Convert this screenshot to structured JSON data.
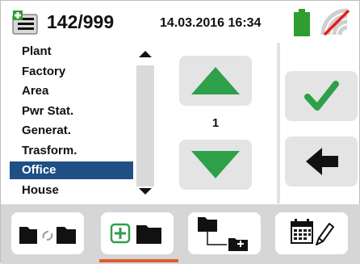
{
  "header": {
    "memory_count": "142/999",
    "datetime": "14.03.2016  16:34",
    "icons": [
      "memory-icon",
      "battery-icon",
      "wifi-off-icon"
    ],
    "battery_color": "#2e9e2e",
    "wifi_off_color": "#e02020"
  },
  "list": {
    "items": [
      "Plant",
      "Factory",
      "Area",
      "Pwr Stat.",
      "Generat.",
      "Trasform.",
      "Office",
      "House"
    ],
    "selected_item": "Office",
    "selection_color": "#1f4f85"
  },
  "selector": {
    "value": "1",
    "arrow_color": "#2ea04a"
  },
  "actions": {
    "confirm_icon": "check-icon",
    "back_icon": "arrow-left-icon",
    "check_color": "#2ea04a"
  },
  "toolbar": {
    "buttons": [
      "move-folder-icon",
      "add-folder-icon",
      "subfolder-icon",
      "calendar-edit-icon"
    ],
    "active_index": 1,
    "active_color": "#e35b2b"
  }
}
